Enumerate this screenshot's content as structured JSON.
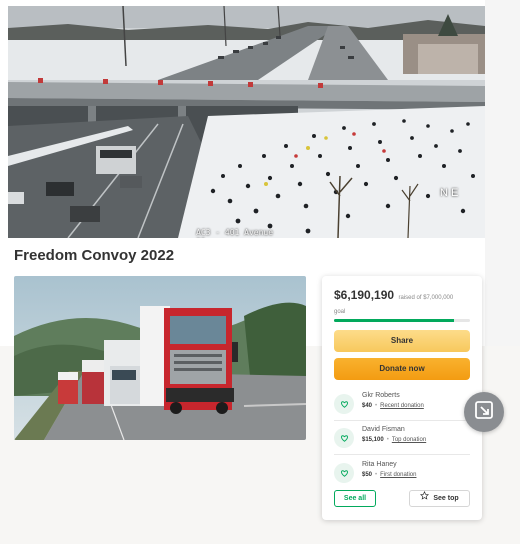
{
  "campaign": {
    "title": "Freedom Convoy 2022"
  },
  "hero_photo": {
    "camera_stamp": "AC3 - 401 Avenue 21",
    "direction_mark": "N E"
  },
  "donation_card": {
    "raised_amount": "$6,190,190",
    "raised_label": "raised of $7,000,000",
    "goal_suffix": "goal",
    "progress_fraction": 0.88,
    "share_label": "Share",
    "donate_label": "Donate now",
    "donors": [
      {
        "name": "Gkr Roberts",
        "amount": "$40",
        "tag": "Recent donation"
      },
      {
        "name": "David Fisman",
        "amount": "$15,100",
        "tag": "Top donation"
      },
      {
        "name": "Rita Haney",
        "amount": "$50",
        "tag": "First donation"
      }
    ],
    "see_all_label": "See all",
    "see_top_label": "See top"
  },
  "colors": {
    "brand_green": "#02a95c",
    "share_yellow": "#f7c85d",
    "donate_orange": "#f39c12",
    "title_text": "#333333"
  },
  "icons": {
    "donor": "heart-hand-icon",
    "star": "star-icon",
    "expand": "expand-icon"
  }
}
